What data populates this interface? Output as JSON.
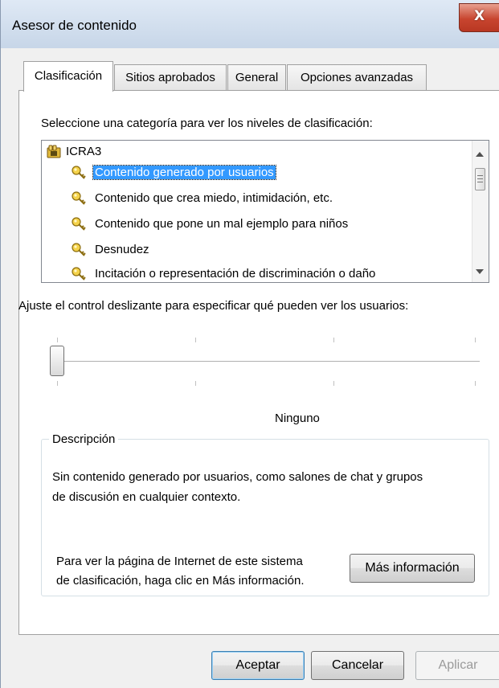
{
  "window": {
    "title": "Asesor de contenido",
    "close_label": "X"
  },
  "tabs": [
    {
      "label": "Clasificación",
      "active": true
    },
    {
      "label": "Sitios aprobados",
      "active": false
    },
    {
      "label": "General",
      "active": false
    },
    {
      "label": "Opciones avanzadas",
      "active": false
    }
  ],
  "category_prompt": "Seleccione una categoría para ver los niveles de clasificación:",
  "categories": {
    "root": "ICRA3",
    "items": [
      {
        "label": "Contenido generado por usuarios",
        "selected": true
      },
      {
        "label": "Contenido que crea miedo, intimidación, etc.",
        "selected": false
      },
      {
        "label": "Contenido que pone un mal ejemplo para niños",
        "selected": false
      },
      {
        "label": "Desnudez",
        "selected": false
      },
      {
        "label": "Incitación o representación de discriminación o daño",
        "selected": false
      }
    ]
  },
  "slider": {
    "prompt": "Ajuste el control deslizante para especificar qué pueden ver los usuarios:",
    "position": 0,
    "level_label": "Ninguno"
  },
  "description": {
    "legend": "Descripción",
    "text_line1": "Sin contenido generado por usuarios, como salones de chat y grupos",
    "text_line2": "de discusión en cualquier contexto.",
    "info_line1": "Para ver la página de Internet de este sistema",
    "info_line2": "de clasificación, haga clic en Más información.",
    "more_info_button": "Más información"
  },
  "buttons": {
    "ok": "Aceptar",
    "cancel": "Cancelar",
    "apply": "Aplicar"
  },
  "colors": {
    "selection": "#3399ff",
    "close_button": "#c8452f"
  }
}
